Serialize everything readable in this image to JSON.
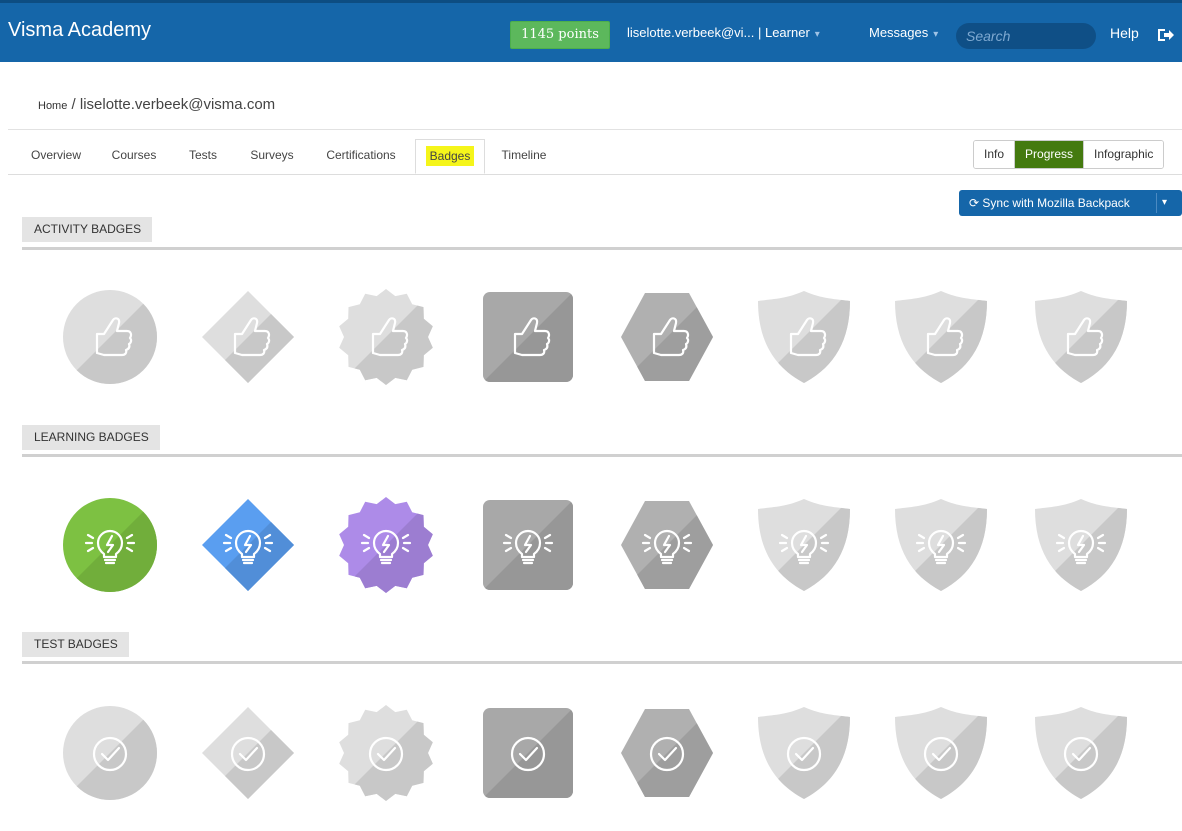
{
  "header": {
    "app_title": "Visma Academy",
    "points": "1145 points",
    "user": "liselotte.verbeek@vi... | Learner",
    "messages": "Messages",
    "search_placeholder": "Search",
    "help": "Help",
    "logout_icon": "logout-icon"
  },
  "breadcrumb": {
    "home": "Home",
    "separator": " / ",
    "current": "liselotte.verbeek@visma.com"
  },
  "tabs": [
    {
      "label": "Overview"
    },
    {
      "label": "Courses"
    },
    {
      "label": "Tests"
    },
    {
      "label": "Surveys"
    },
    {
      "label": "Certifications"
    },
    {
      "label": "Badges",
      "active": true
    },
    {
      "label": "Timeline"
    }
  ],
  "view_toggle": [
    {
      "label": "Info"
    },
    {
      "label": "Progress",
      "active": true
    },
    {
      "label": "Infographic"
    }
  ],
  "sync_button": {
    "label": "Sync with Mozilla Backpack",
    "icon": "refresh-icon"
  },
  "sections": [
    {
      "title": "ACTIVITY BADGES",
      "icon": "thumbs-up-icon",
      "badges": [
        {
          "shape": "circle",
          "earned": false
        },
        {
          "shape": "diamond",
          "earned": false
        },
        {
          "shape": "seal",
          "earned": false
        },
        {
          "shape": "square",
          "earned": false
        },
        {
          "shape": "hexagon",
          "earned": false
        },
        {
          "shape": "shield",
          "earned": false
        },
        {
          "shape": "shield",
          "earned": false
        },
        {
          "shape": "shield",
          "earned": false
        }
      ]
    },
    {
      "title": "LEARNING BADGES",
      "icon": "lightbulb-icon",
      "badges": [
        {
          "shape": "circle",
          "earned": true,
          "color": "#7dc142"
        },
        {
          "shape": "diamond",
          "earned": true,
          "color": "#5a9ef0"
        },
        {
          "shape": "seal",
          "earned": true,
          "color": "#ad8be8"
        },
        {
          "shape": "square",
          "earned": false
        },
        {
          "shape": "hexagon",
          "earned": false
        },
        {
          "shape": "shield",
          "earned": false
        },
        {
          "shape": "shield",
          "earned": false
        },
        {
          "shape": "shield",
          "earned": false
        }
      ]
    },
    {
      "title": "TEST BADGES",
      "icon": "checkmark-circle-icon",
      "badges": [
        {
          "shape": "circle",
          "earned": false
        },
        {
          "shape": "diamond",
          "earned": false
        },
        {
          "shape": "seal",
          "earned": false
        },
        {
          "shape": "square",
          "earned": false
        },
        {
          "shape": "hexagon",
          "earned": false
        },
        {
          "shape": "shield",
          "earned": false
        },
        {
          "shape": "shield",
          "earned": false
        },
        {
          "shape": "shield",
          "earned": false
        }
      ]
    }
  ],
  "colors": {
    "header_bg": "#1566a9",
    "points_bg": "#5cb85c",
    "progress_active": "#447a0f",
    "tab_highlight": "#f5f51a",
    "badge_gray_square": "#a8a8a8",
    "badge_gray_hexagon": "#b0b0b0",
    "badge_gray_light": "#dedede"
  }
}
